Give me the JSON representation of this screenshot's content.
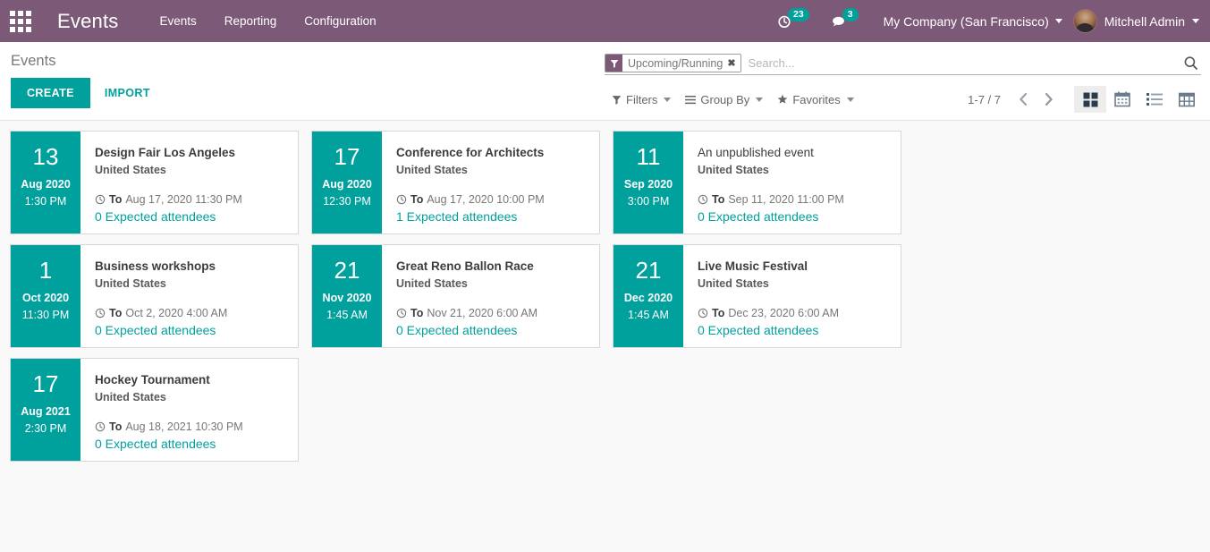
{
  "navbar": {
    "apps_icon": "apps-grid-icon",
    "brand": "Events",
    "menu": [
      {
        "label": "Events"
      },
      {
        "label": "Reporting"
      },
      {
        "label": "Configuration"
      }
    ],
    "activity": {
      "icon": "clock-icon",
      "count": "23"
    },
    "messages": {
      "icon": "speech-bubble-icon",
      "count": "3"
    },
    "company": "My Company (San Francisco)",
    "user": "Mitchell Admin"
  },
  "control_panel": {
    "breadcrumb": "Events",
    "create_label": "CREATE",
    "import_label": "IMPORT",
    "search": {
      "facet_icon": "filter-funnel-icon",
      "facet_label": "Upcoming/Running",
      "facet_close": "✖",
      "placeholder": "Search...",
      "search_icon": "magnifier-icon"
    },
    "filters_label": "Filters",
    "groupby_label": "Group By",
    "favorites_label": "Favorites",
    "pager": "1-7 / 7",
    "prev_icon": "chevron-left-icon",
    "next_icon": "chevron-right-icon",
    "views": [
      {
        "name": "kanban",
        "icon": "kanban-icon",
        "active": true
      },
      {
        "name": "calendar",
        "icon": "calendar-icon",
        "active": false
      },
      {
        "name": "list",
        "icon": "list-icon",
        "active": false
      },
      {
        "name": "pivot",
        "icon": "pivot-icon",
        "active": false
      }
    ]
  },
  "events": [
    {
      "day": "13",
      "month_year": "Aug 2020",
      "time": "1:30 PM",
      "title": "Design Fair Los Angeles",
      "title_bold": true,
      "country": "United States",
      "to_label": "To",
      "to_date": "Aug 17, 2020 11:30 PM",
      "attendees": "0 Expected attendees"
    },
    {
      "day": "17",
      "month_year": "Aug 2020",
      "time": "12:30 PM",
      "title": "Conference for Architects",
      "title_bold": true,
      "country": "United States",
      "to_label": "To",
      "to_date": "Aug 17, 2020 10:00 PM",
      "attendees": "1 Expected attendees"
    },
    {
      "day": "11",
      "month_year": "Sep 2020",
      "time": "3:00 PM",
      "title": "An unpublished event",
      "title_bold": false,
      "country": "United States",
      "to_label": "To",
      "to_date": "Sep 11, 2020 11:00 PM",
      "attendees": "0 Expected attendees"
    },
    {
      "day": "1",
      "month_year": "Oct 2020",
      "time": "11:30 PM",
      "title": "Business workshops",
      "title_bold": true,
      "country": "United States",
      "to_label": "To",
      "to_date": "Oct 2, 2020 4:00 AM",
      "attendees": "0 Expected attendees"
    },
    {
      "day": "21",
      "month_year": "Nov 2020",
      "time": "1:45 AM",
      "title": "Great Reno Ballon Race",
      "title_bold": true,
      "country": "United States",
      "to_label": "To",
      "to_date": "Nov 21, 2020 6:00 AM",
      "attendees": "0 Expected attendees"
    },
    {
      "day": "21",
      "month_year": "Dec 2020",
      "time": "1:45 AM",
      "title": "Live Music Festival",
      "title_bold": true,
      "country": "United States",
      "to_label": "To",
      "to_date": "Dec 23, 2020 6:00 AM",
      "attendees": "0 Expected attendees"
    },
    {
      "day": "17",
      "month_year": "Aug 2021",
      "time": "2:30 PM",
      "title": "Hockey Tournament",
      "title_bold": true,
      "country": "United States",
      "to_label": "To",
      "to_date": "Aug 18, 2021 10:30 PM",
      "attendees": "0 Expected attendees"
    }
  ],
  "colors": {
    "navbar": "#7c5a77",
    "accent_teal": "#00a09d",
    "board_bg": "#f9f9f9",
    "card_border": "#d6d9dc"
  }
}
